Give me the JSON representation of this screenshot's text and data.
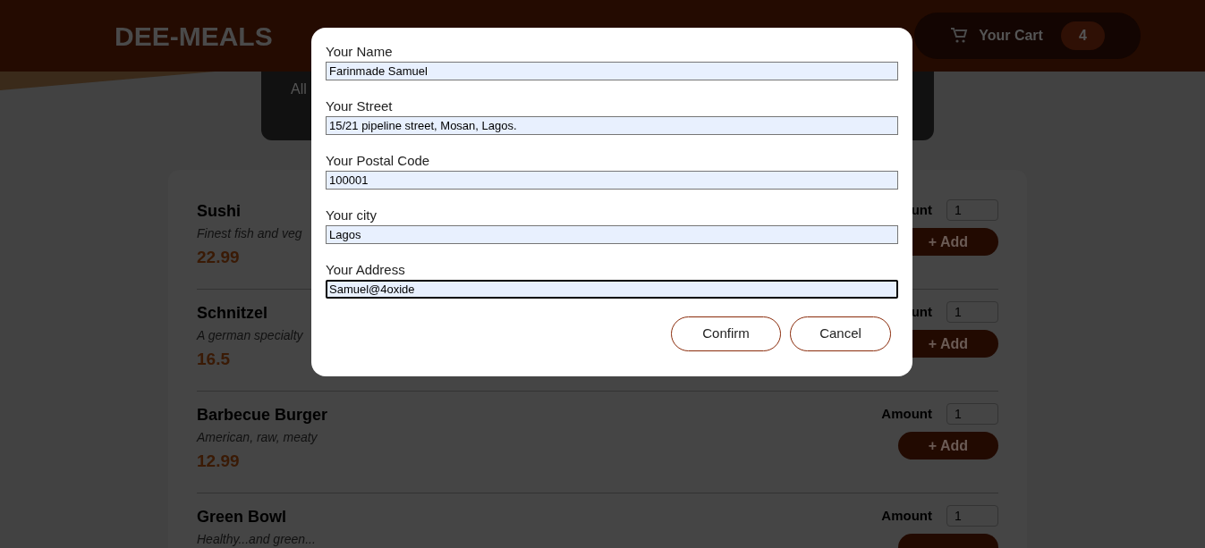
{
  "header": {
    "logo": "DEE-MEALS",
    "cart": {
      "label": "Your Cart",
      "count": "4"
    }
  },
  "summary": {
    "text": "All"
  },
  "meals": [
    {
      "name": "Sushi",
      "description": "Finest fish and veg",
      "price": "22.99",
      "amount_label": "unt",
      "amount": "1",
      "add_button": "+ Add"
    },
    {
      "name": "Schnitzel",
      "description": "A german specialty",
      "price": "16.5",
      "amount_label": "unt",
      "amount": "1",
      "add_button": "+ Add"
    },
    {
      "name": "Barbecue Burger",
      "description": "American, raw, meaty",
      "price": "12.99",
      "amount_label": "Amount",
      "amount": "1",
      "add_button": "+ Add"
    },
    {
      "name": "Green Bowl",
      "description": "Healthy...and green...",
      "amount_label": "Amount",
      "amount": "1"
    }
  ],
  "modal": {
    "fields": [
      {
        "label": "Your Name",
        "value": "Farinmade Samuel",
        "focused": false
      },
      {
        "label": "Your Street",
        "value": "15/21 pipeline street, Mosan, Lagos.",
        "focused": false
      },
      {
        "label": "Your Postal Code",
        "value": "100001",
        "focused": false
      },
      {
        "label": "Your city",
        "value": "Lagos",
        "focused": false
      },
      {
        "label": "Your Address",
        "value": "Samuel@4oxide",
        "focused": true
      }
    ],
    "buttons": [
      "Confirm",
      "Cancel"
    ]
  }
}
